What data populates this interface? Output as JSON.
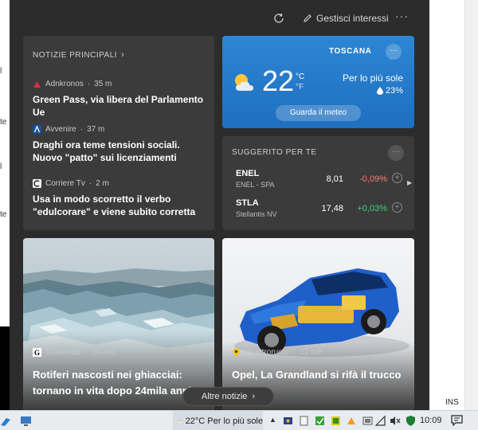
{
  "panel": {
    "manage_label": "Gestisci interessi",
    "more_label": "···",
    "more_news_label": "Altre notizie"
  },
  "news": {
    "header": "NOTIZIE PRINCIPALI",
    "items": [
      {
        "source": "Adnkronos",
        "age": "35 m",
        "headline": "Green Pass, via libera del Parlamento Ue"
      },
      {
        "source": "Avvenire",
        "age": "37 m",
        "headline": "Draghi ora teme tensioni sociali. Nuovo \"patto\" sui licenziamenti"
      },
      {
        "source": "Corriere Tv",
        "age": "2 m",
        "headline": "Usa in modo scorretto il verbo \"edulcorare\" e viene subito corretta"
      }
    ]
  },
  "weather": {
    "region": "TOSCANA",
    "more": "···",
    "temp": "22",
    "unit_c": "°C",
    "unit_f": "°F",
    "condition": "Per lo più sole",
    "precip": "23%",
    "button": "Guarda il meteo",
    "icon": "partly-sunny-icon"
  },
  "stocks": {
    "header": "SUGGERITO PER TE",
    "more": "···",
    "items": [
      {
        "symbol": "ENEL",
        "name": "ENEL - SPA",
        "price": "8,01",
        "change": "-0,09%",
        "direction": "down"
      },
      {
        "symbol": "STLA",
        "name": "Stellantis NV",
        "price": "17,48",
        "change": "+0,03%",
        "direction": "up"
      }
    ],
    "colors": {
      "down": "#ff7b6b",
      "up": "#3fd17a"
    }
  },
  "cards": [
    {
      "source": "Il Giornale",
      "age": "20 ore",
      "headline": "Rotiferi nascosti nei ghiacciai: tornano in vita dopo 24mila anni"
    },
    {
      "source": "Quattroruote",
      "age": "11 ore",
      "headline": "Opel, La Grandland si rifà il trucco"
    }
  ],
  "taskbar": {
    "weather_text": "22°C  Per lo più sole",
    "clock": "10:09",
    "ins": "INS"
  }
}
